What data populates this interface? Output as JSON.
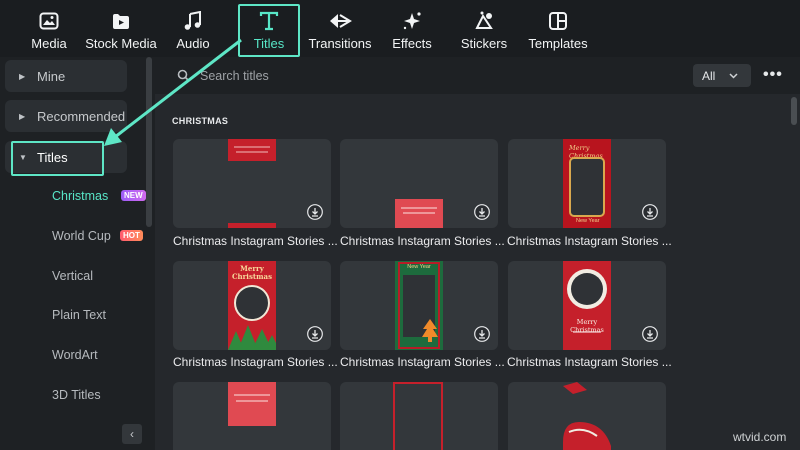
{
  "toolbar": {
    "items": [
      {
        "label": "Media",
        "icon": "media-icon"
      },
      {
        "label": "Stock Media",
        "icon": "stock-media-icon"
      },
      {
        "label": "Audio",
        "icon": "music-note-icon"
      },
      {
        "label": "Titles",
        "icon": "text-t-icon"
      },
      {
        "label": "Transitions",
        "icon": "transitions-icon"
      },
      {
        "label": "Effects",
        "icon": "effects-star-icon"
      },
      {
        "label": "Stickers",
        "icon": "stickers-icon"
      },
      {
        "label": "Templates",
        "icon": "templates-icon"
      }
    ],
    "active": "Titles"
  },
  "sidebar": {
    "groups": [
      {
        "label": "Mine"
      },
      {
        "label": "Recommended"
      },
      {
        "label": "Titles"
      }
    ],
    "subitems": [
      {
        "label": "Christmas",
        "badge": "NEW"
      },
      {
        "label": "World Cup",
        "badge": "HOT"
      },
      {
        "label": "Vertical"
      },
      {
        "label": "Plain Text"
      },
      {
        "label": "WordArt"
      },
      {
        "label": "3D Titles"
      }
    ],
    "collapse_glyph": "‹"
  },
  "search": {
    "placeholder": "Search titles",
    "filter_value": "All",
    "more_glyph": "•••"
  },
  "section": {
    "title": "CHRISTMAS"
  },
  "cards": [
    {
      "label": "Christmas Instagram Stories ..."
    },
    {
      "label": "Christmas Instagram Stories ..."
    },
    {
      "label": "Christmas Instagram Stories ..."
    },
    {
      "label": "Christmas Instagram Stories ..."
    },
    {
      "label": "Christmas Instagram Stories ..."
    },
    {
      "label": "Christmas Instagram Stories ..."
    }
  ],
  "thumb_text": {
    "merry_christmas": "Merry Christmas",
    "merry": "Merry",
    "christmas": "Christmas",
    "new_year": "New Year"
  },
  "colors": {
    "accent": "#58e6c7",
    "highlight": "#5ee6c6",
    "card_red": "#c5202b",
    "dark_red": "#9b1520",
    "green": "#1d6b3d"
  },
  "watermark": "wtvid.com"
}
